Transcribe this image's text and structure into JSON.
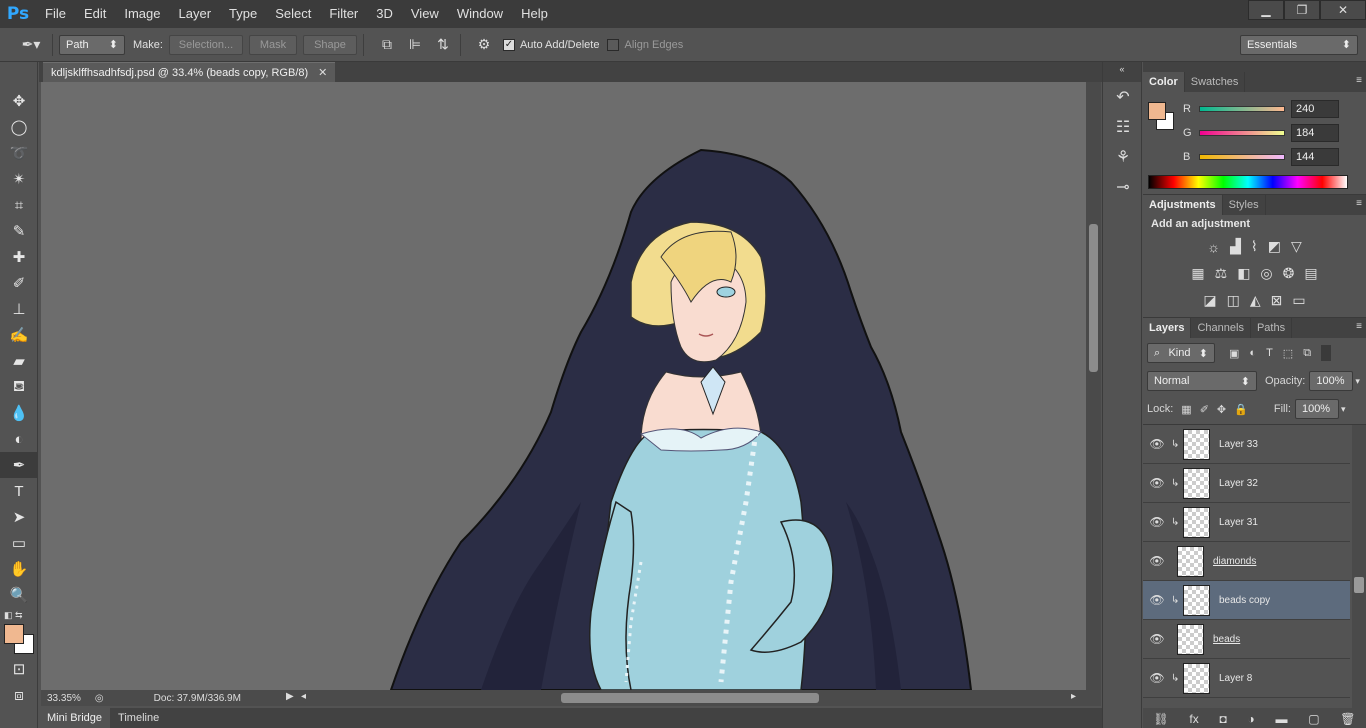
{
  "app": {
    "logo": "Ps"
  },
  "menu": [
    "File",
    "Edit",
    "Image",
    "Layer",
    "Type",
    "Select",
    "Filter",
    "3D",
    "View",
    "Window",
    "Help"
  ],
  "window_controls": {
    "minimize": "▁",
    "restore": "❐",
    "close": "✕"
  },
  "options": {
    "mode": "Path",
    "make_label": "Make:",
    "selection_btn": "Selection...",
    "mask_btn": "Mask",
    "shape_btn": "Shape",
    "auto_add_delete": "Auto Add/Delete",
    "auto_add_delete_checked": true,
    "align_edges": "Align Edges",
    "align_edges_checked": false,
    "workspace": "Essentials"
  },
  "document": {
    "tab_title": "kdljsklffhsadhfsdj.psd @ 33.4% (beads copy, RGB/8)",
    "zoom": "33.35%",
    "doc_size": "Doc: 37.9M/336.9M"
  },
  "bottom_tabs": [
    "Mini Bridge",
    "Timeline"
  ],
  "color_panel": {
    "tabs": [
      "Color",
      "Swatches"
    ],
    "foreground": "#f0b890",
    "r_label": "R",
    "r_value": "240",
    "g_label": "G",
    "g_value": "184",
    "b_label": "B",
    "b_value": "144"
  },
  "adjustments_panel": {
    "tabs": [
      "Adjustments",
      "Styles"
    ],
    "heading": "Add an adjustment"
  },
  "layers_panel": {
    "tabs": [
      "Layers",
      "Channels",
      "Paths"
    ],
    "filter_kind": "Kind",
    "blend_mode": "Normal",
    "opacity_label": "Opacity:",
    "opacity": "100%",
    "lock_label": "Lock:",
    "fill_label": "Fill:",
    "fill": "100%",
    "layers": [
      {
        "name": "Layer 33",
        "clipped": true,
        "underline": false,
        "selected": false
      },
      {
        "name": "Layer 32",
        "clipped": true,
        "underline": false,
        "selected": false
      },
      {
        "name": "Layer 31",
        "clipped": true,
        "underline": false,
        "selected": false
      },
      {
        "name": "diamonds",
        "clipped": false,
        "underline": true,
        "selected": false
      },
      {
        "name": "beads copy",
        "clipped": true,
        "underline": false,
        "selected": true
      },
      {
        "name": "beads",
        "clipped": false,
        "underline": true,
        "selected": false
      },
      {
        "name": "Layer 8",
        "clipped": true,
        "underline": false,
        "selected": false
      }
    ]
  }
}
